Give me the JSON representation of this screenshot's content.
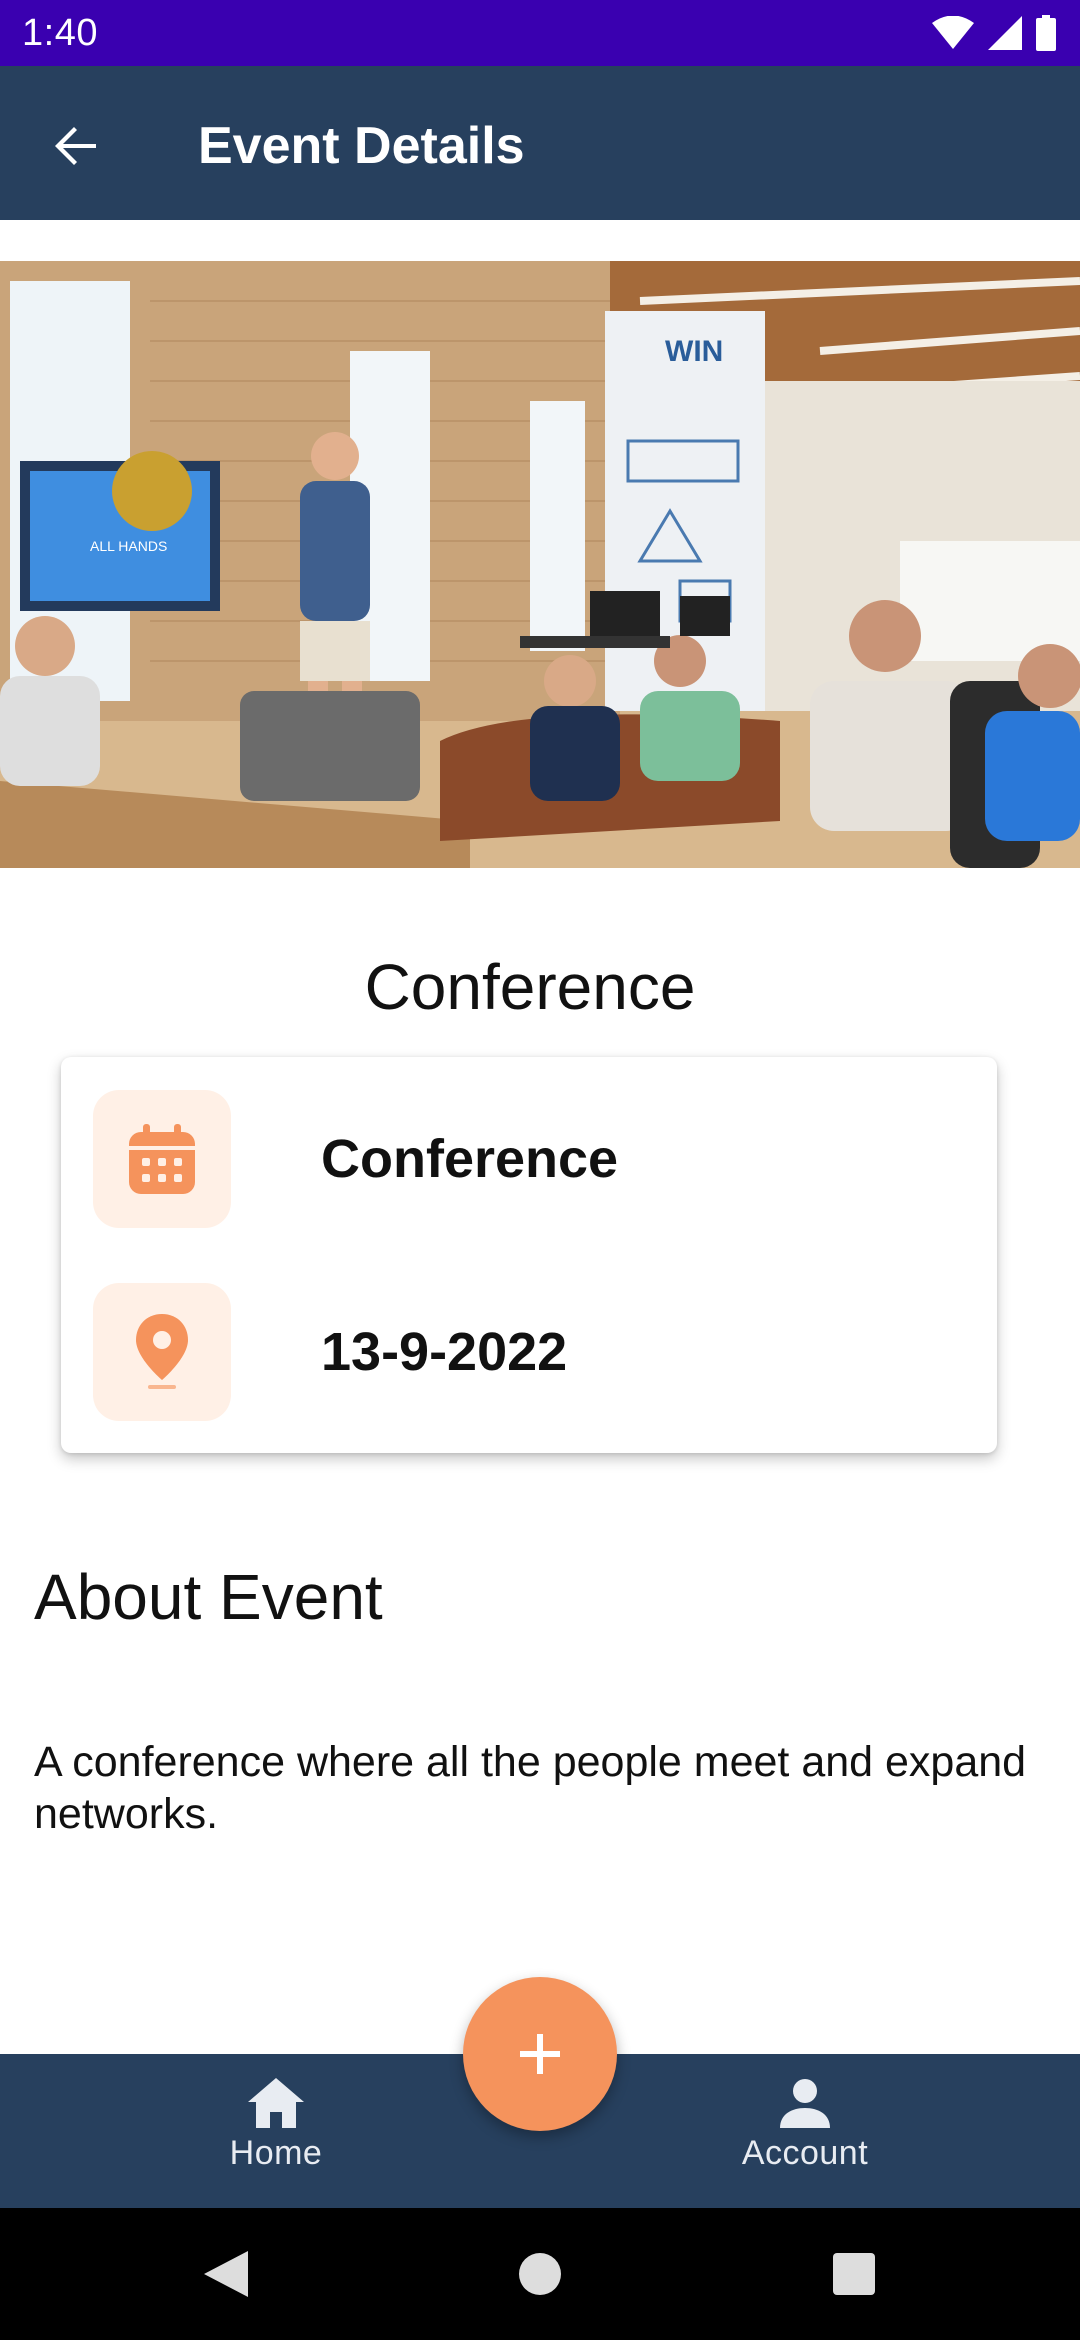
{
  "status_bar": {
    "time": "1:40",
    "icons": [
      "wifi-icon",
      "signal-icon",
      "battery-icon"
    ]
  },
  "app_bar": {
    "title": "Event Details",
    "back_icon": "arrow-left-icon"
  },
  "hero_image": {
    "description_icon": "photo"
  },
  "event": {
    "title": "Conference",
    "category": "Conference",
    "date": "13-9-2022",
    "category_icon": "calendar-icon",
    "date_icon": "location-pin-icon"
  },
  "about": {
    "heading": "About Event",
    "body": "A conference where all the people meet and expand networks."
  },
  "bottom_nav": {
    "items": [
      {
        "label": "Home",
        "icon": "home-icon"
      },
      {
        "label": "Account",
        "icon": "person-icon"
      }
    ],
    "fab_icon": "plus-icon"
  },
  "colors": {
    "status_bar": "#3a00b0",
    "app_bar": "#27405e",
    "accent": "#f5935c",
    "icon_bg": "#fff0e6",
    "nav_bg": "#27405e"
  }
}
